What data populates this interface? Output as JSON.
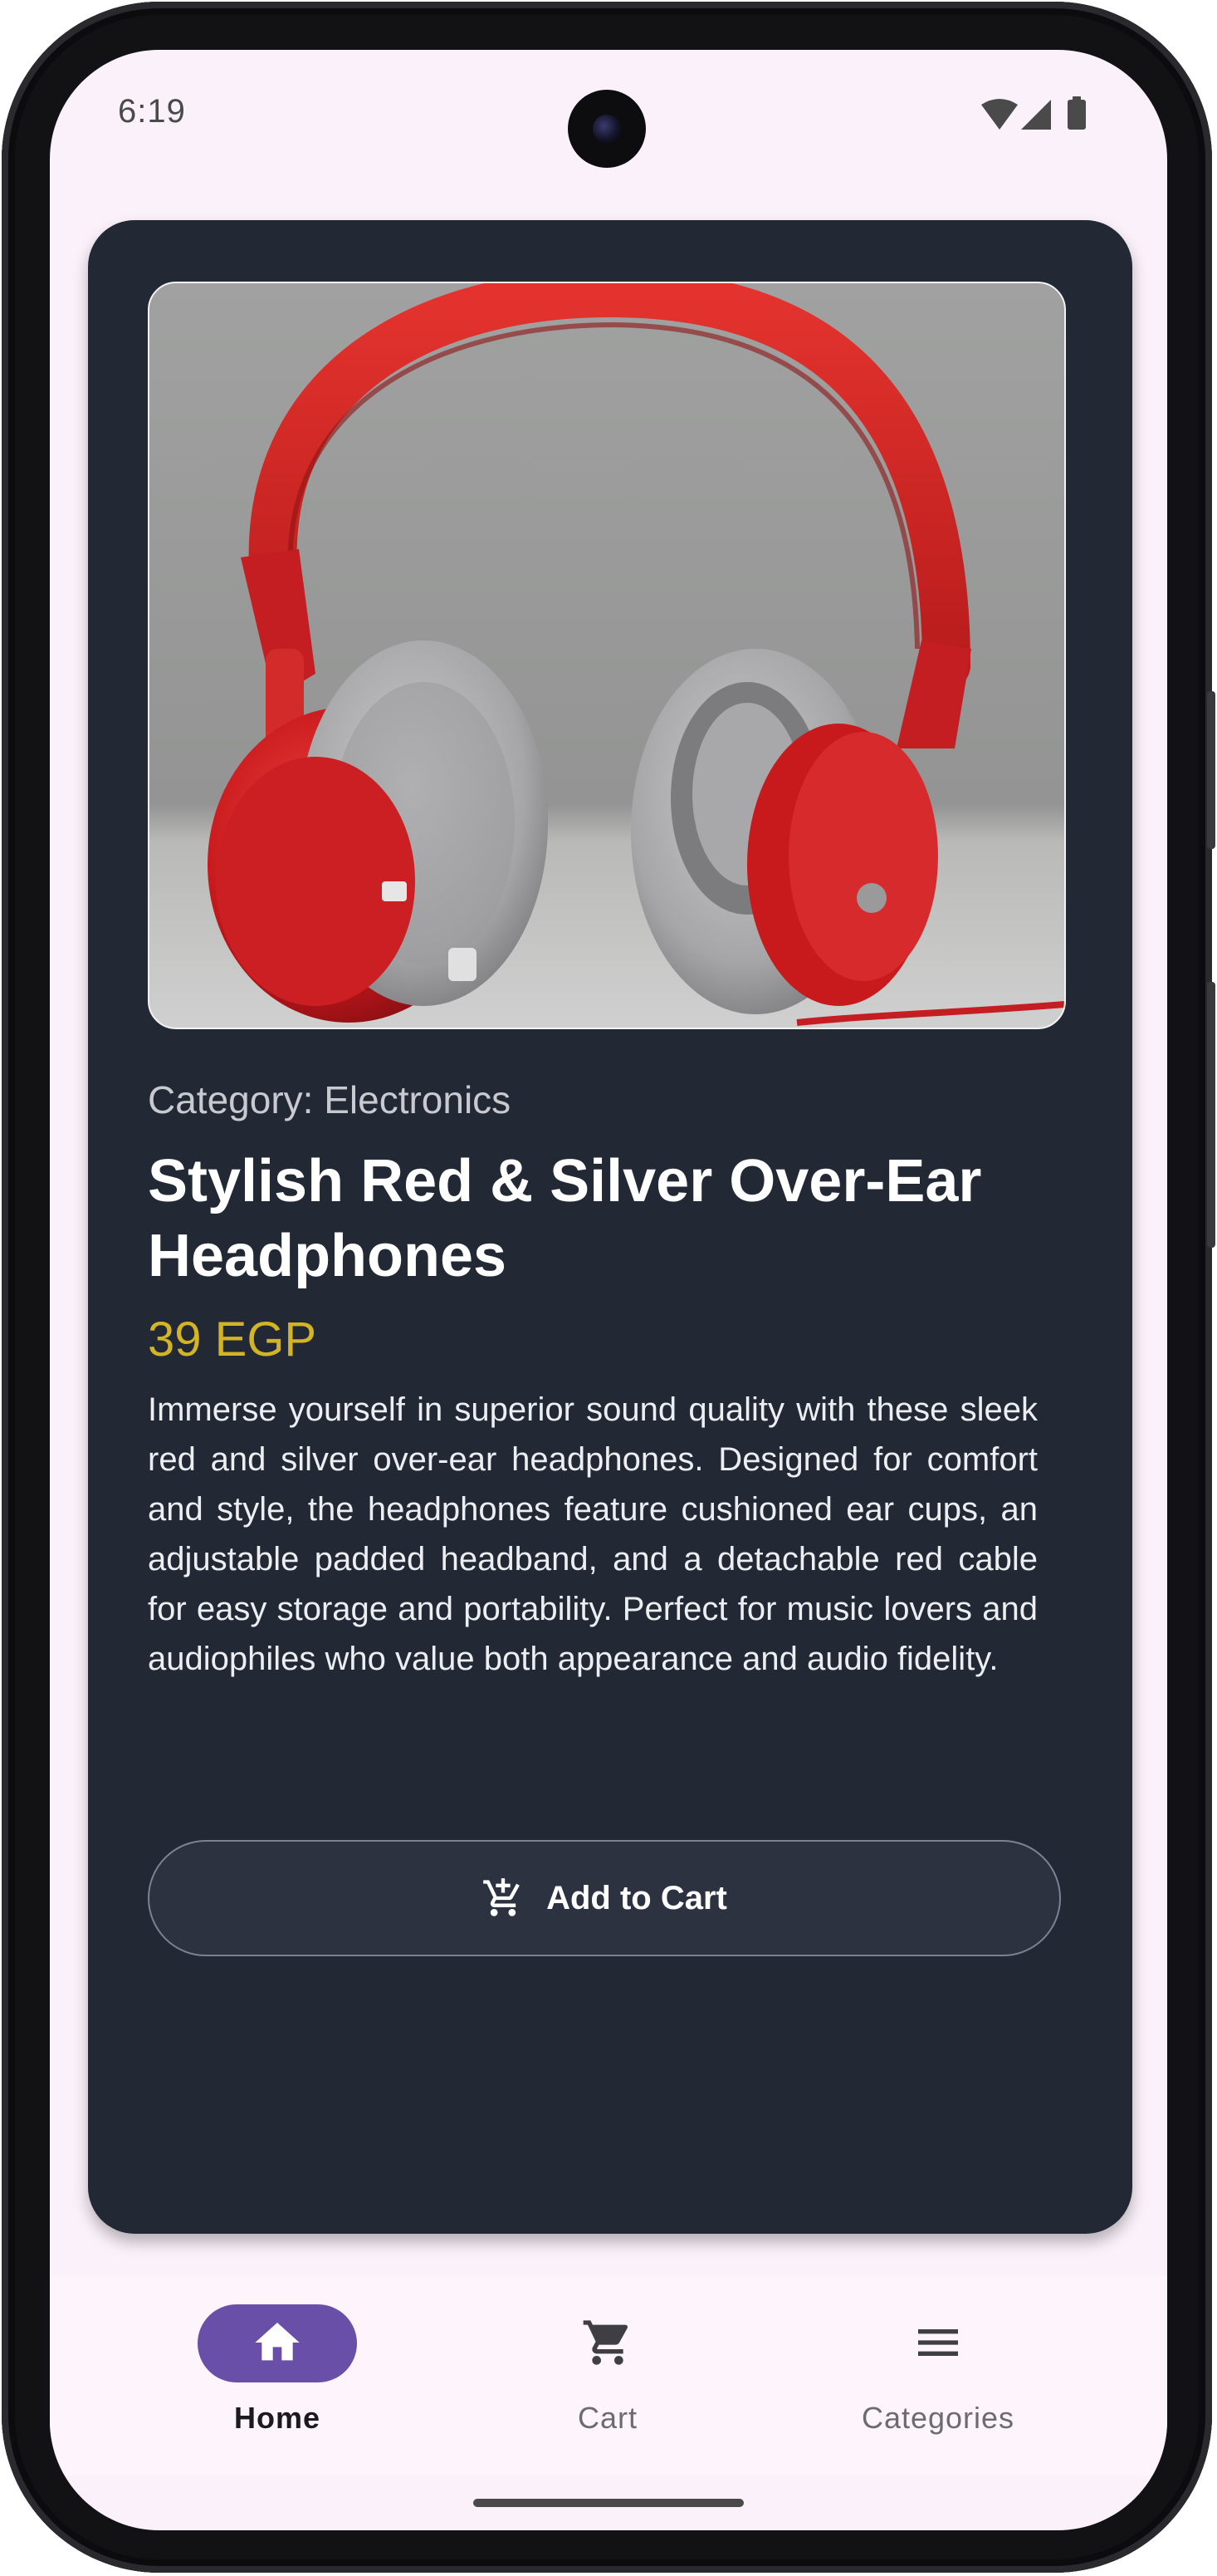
{
  "status_bar": {
    "time": "6:19",
    "icons": [
      "wifi-icon",
      "signal-icon",
      "battery-icon"
    ]
  },
  "product": {
    "image": "red-silver-headphones",
    "category": "Category: Electronics",
    "title": "Stylish Red & Silver Over-Ear Headphones",
    "price": "39 EGP",
    "description": "Immerse yourself in superior sound quality with these sleek red and silver over-ear headphones. Designed for comfort and style, the headphones feature cushioned ear cups, an adjustable padded headband, and a detachable red cable for easy storage and portability. Perfect for music lovers and audiophiles who value both appearance and audio fidelity.",
    "add_to_cart_label": "Add to Cart",
    "add_to_cart_icon": "add-shopping-cart-icon"
  },
  "bottom_nav": {
    "items": [
      {
        "label": "Home",
        "icon": "home-icon",
        "active": true
      },
      {
        "label": "Cart",
        "icon": "cart-icon",
        "active": false
      },
      {
        "label": "Categories",
        "icon": "menu-icon",
        "active": false
      }
    ]
  },
  "colors": {
    "card_background": "#222834",
    "screen_background": "#fbf1fb",
    "price": "#d3b424",
    "nav_active_pill": "#6a4fa8"
  }
}
